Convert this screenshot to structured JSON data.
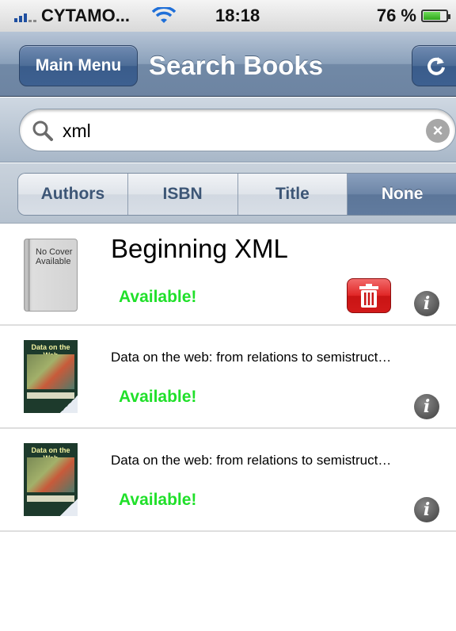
{
  "status_bar": {
    "carrier": "CYTAMO...",
    "time": "18:18",
    "battery_percent": "76 %",
    "battery_level": 0.76
  },
  "nav": {
    "back_label": "Main Menu",
    "title": "Search Books",
    "refresh_icon": "refresh-icon"
  },
  "search": {
    "value": "xml",
    "placeholder": ""
  },
  "segments": [
    {
      "label": "Authors",
      "selected": false
    },
    {
      "label": "ISBN",
      "selected": false
    },
    {
      "label": "Title",
      "selected": false
    },
    {
      "label": "None",
      "selected": true
    }
  ],
  "results": [
    {
      "title": "Beginning XML",
      "cover_text": "No Cover Available",
      "status": "Available!",
      "has_delete": true
    },
    {
      "title": "Data on the web: from relations to semistruct…",
      "cover_text": "Data on the Web",
      "status": "Available!",
      "has_delete": false
    },
    {
      "title": "Data on the web: from relations to semistruct…",
      "cover_text": "Data on the Web",
      "status": "Available!",
      "has_delete": false
    }
  ],
  "colors": {
    "available": "#20e02a",
    "delete": "#d21a1a",
    "nav": "#6d84a2"
  }
}
